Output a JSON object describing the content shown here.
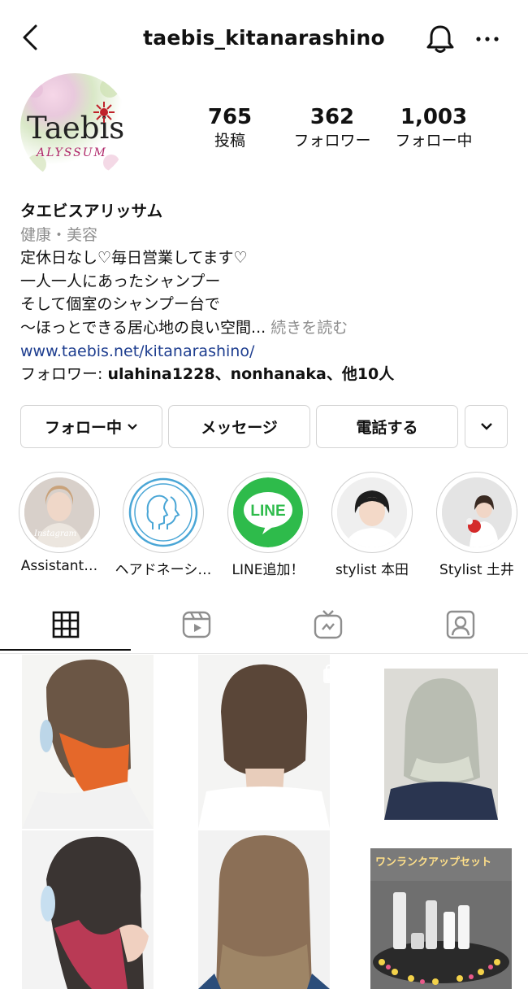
{
  "header": {
    "username": "taebis_kitanarashino",
    "back_icon": "chevron-left-icon",
    "bell_icon": "bell-icon",
    "more_icon": "ellipsis-icon"
  },
  "profile": {
    "avatar_icon": "taebis-alyssum-logo",
    "logo_text": "Taebis",
    "logo_subtext": "ALYSSUM",
    "stats": [
      {
        "value": "765",
        "label": "投稿"
      },
      {
        "value": "362",
        "label": "フォロワー"
      },
      {
        "value": "1,003",
        "label": "フォロー中"
      }
    ],
    "name": "タエビスアリッサム",
    "category": "健康・美容",
    "bio_lines": [
      "定休日なし♡毎日営業してます♡",
      "一人一人にあったシャンプー",
      "そして個室のシャンプー台で"
    ],
    "bio_last": "〜ほっとできる居心地の良い空間...",
    "more_label": " 続きを読む",
    "website": "www.taebis.net/kitanarashino/",
    "followed_prefix": "フォロワー: ",
    "followed_names": "ulahina1228、nonhanaka、他10人"
  },
  "actions": {
    "following_label": "フォロー中",
    "message_label": "メッセージ",
    "call_label": "電話する",
    "chevron_icon": "chevron-down-icon"
  },
  "highlights": [
    {
      "label": "Assistant…"
    },
    {
      "label": "ヘアドネーシ…"
    },
    {
      "label": "LINE追加！"
    },
    {
      "label": "stylist 本田"
    },
    {
      "label": "Stylist 土井"
    }
  ],
  "line_logo_text": "LINE",
  "tabs": [
    {
      "name": "grid",
      "icon": "grid-icon",
      "active": true
    },
    {
      "name": "reels",
      "icon": "reels-icon",
      "active": false
    },
    {
      "name": "igtv",
      "icon": "tv-icon",
      "active": false
    },
    {
      "name": "tagged",
      "icon": "tagged-person-icon",
      "active": false
    }
  ],
  "posts": [
    {
      "desc": "orange inner color hair"
    },
    {
      "desc": "short brown hair back view"
    },
    {
      "desc": "grey ash bob"
    },
    {
      "desc": "pink inner color hair"
    },
    {
      "desc": "long brown straight hair"
    },
    {
      "desc": "product set promo"
    }
  ],
  "promo_text": "ワンランクアップセット",
  "colors": {
    "link": "#1d3d8f",
    "secondary_text": "#8e8e8e",
    "line_green": "#2ebb4b",
    "logo_red": "#c0222a"
  }
}
